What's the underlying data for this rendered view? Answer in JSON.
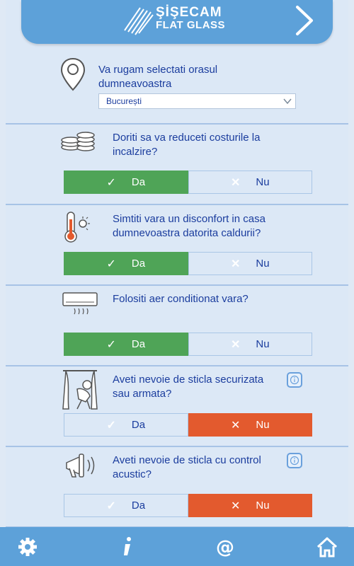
{
  "header": {
    "logo_line1": "ŞİŞECAM",
    "logo_line2": "FLAT GLASS"
  },
  "city": {
    "prompt": "Va rugam selectati orasul dumneavoastra",
    "selected": "București"
  },
  "questions": [
    {
      "text": "Doriti sa va reduceti costurile la incalzire?",
      "yes_label": "Da",
      "no_label": "Nu",
      "selected": "Da"
    },
    {
      "text": "Simtiti vara un disconfort in casa dumnevoastra datorita caldurii?",
      "yes_label": "Da",
      "no_label": "Nu",
      "selected": "Da"
    },
    {
      "text": "Folositi aer conditionat vara?",
      "yes_label": "Da",
      "no_label": "Nu",
      "selected": "Da"
    },
    {
      "text": "Aveti nevoie de sticla securizata sau armata?",
      "yes_label": "Da",
      "no_label": "Nu",
      "selected": "Nu"
    },
    {
      "text": "Aveti nevoie de sticla cu control acustic?",
      "yes_label": "Da",
      "no_label": "Nu",
      "selected": "Nu"
    }
  ],
  "icons": {
    "footer": [
      "gear-icon",
      "info-icon",
      "at-icon",
      "home-icon"
    ]
  },
  "colors": {
    "header": "#5da1d9",
    "yes_active": "#4fa457",
    "no_active": "#e35a2e",
    "text": "#1b3d9e"
  }
}
